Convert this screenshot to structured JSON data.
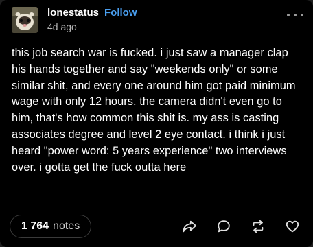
{
  "post": {
    "username": "lonestatus",
    "follow_label": "Follow",
    "timestamp": "4d ago",
    "body": "this job search war is fucked. i just saw a manager clap his hands together and say \"weekends only\" or some similar shit, and every one around him got paid minimum wage with only 12 hours. the camera didn't even go to him, that's how common this shit is. my ass is casting associates degree and level 2 eye contact. i think i just heard \"power word: 5 years experience\" two interviews over. i gotta get the fuck outta here"
  },
  "footer": {
    "notes_count": "1 764",
    "notes_label": "notes"
  },
  "icons": {
    "avatar": "ferret-avatar",
    "more": "more-options-icon",
    "share": "share-icon",
    "reply": "reply-icon",
    "reblog": "reblog-icon",
    "like": "heart-icon"
  },
  "colors": {
    "background": "#000000",
    "accent": "#4a9ff0",
    "text": "#ffffff",
    "muted": "#b3b3b3"
  }
}
